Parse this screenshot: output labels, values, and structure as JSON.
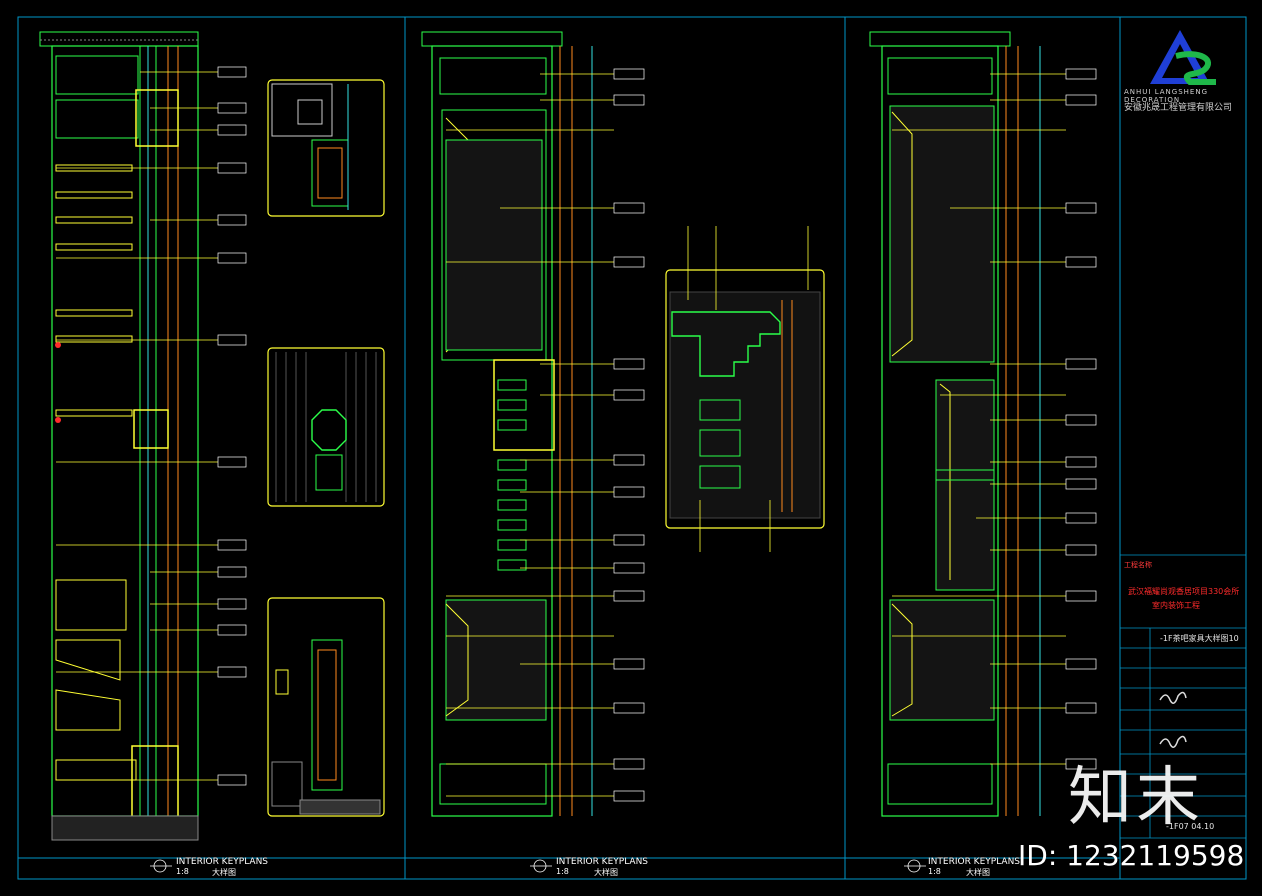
{
  "title_block": {
    "company_en": "ANHUI LANGSHENG DECORATION",
    "company_cn": "安徽兆晟工程管理有限公司",
    "project_label": "工程名称",
    "project_name": "武汉福耀尚观香居项目330会所",
    "project_sub": "室内装饰工程",
    "drawing_title": "-1F茶吧家具大样图10",
    "sheet_no": "-1F07 04.10"
  },
  "panels": [
    {
      "id": "1",
      "keyplan": "INTERIOR KEYPLANS",
      "scale": "1:8",
      "cn_label": "大样图"
    },
    {
      "id": "2",
      "keyplan": "INTERIOR KEYPLANS",
      "scale": "1:8",
      "cn_label": "大样图"
    },
    {
      "id": "3",
      "keyplan": "INTERIOR KEYPLANS",
      "scale": "1:8",
      "cn_label": "大样图"
    }
  ],
  "watermark": {
    "brand": "知末",
    "id_text": "ID: 1232119598"
  },
  "colors": {
    "background": "#000000",
    "frame": "#00c8ff",
    "green": "#2bff4a",
    "yellow": "#ffff33",
    "red": "#ff2b2b",
    "cyan": "#33e0e0",
    "orange": "#ff8a1e",
    "logo_blue": "#1f3fd6",
    "logo_green": "#1fb84a"
  }
}
